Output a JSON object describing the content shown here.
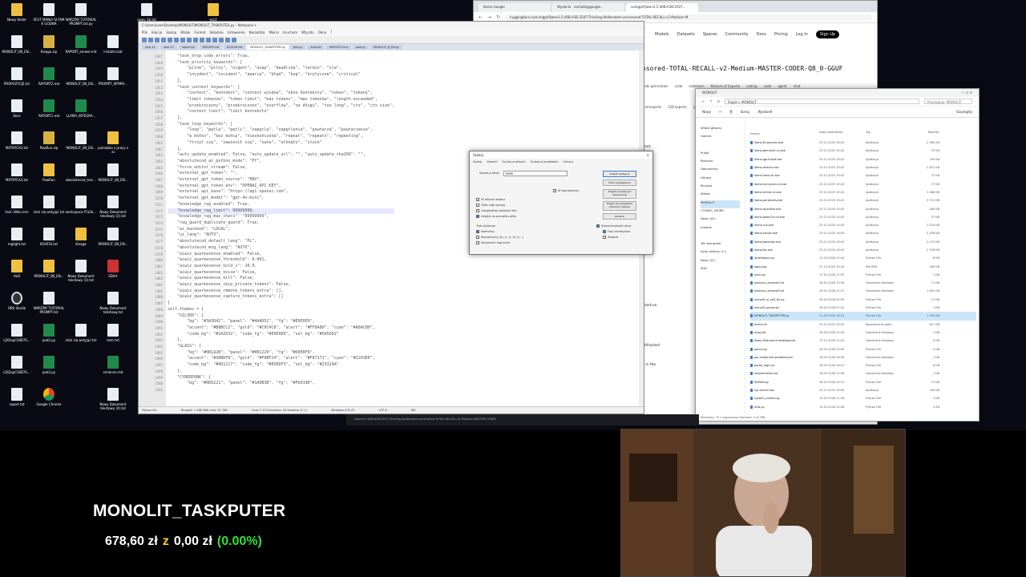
{
  "desktop_icons": [
    {
      "label": "Nowy folder",
      "kind": "folder"
    },
    {
      "label": "SFUT MANIA SI FAM K GODNA",
      "kind": "file"
    },
    {
      "label": "WARZNY TUTORIAL PROMPT.txt.py",
      "kind": "file"
    },
    {
      "label": "nowy 1b.txt",
      "kind": "file"
    },
    {
      "label": "sec2",
      "kind": "folder"
    },
    {
      "label": "MONOLIT_BII_EN...",
      "kind": "file"
    },
    {
      "label": "Księga.zip",
      "kind": "zip"
    },
    {
      "label": "RAPORT_serwer.md",
      "kind": "excel"
    },
    {
      "label": "installer.bat",
      "kind": "file"
    },
    {
      "label": "PROPOZYCJE.txt",
      "kind": "file"
    },
    {
      "label": "RAPORT2.md",
      "kind": "excel"
    },
    {
      "label": "MONOLIT_BII_EN...",
      "kind": "file"
    },
    {
      "label": "PROMPT_WYMIA...",
      "kind": "file"
    },
    {
      "label": "Kosz",
      "kind": "file"
    },
    {
      "label": "RAPORT1.md",
      "kind": "excel"
    },
    {
      "label": "LLAMA_INTEGRA...",
      "kind": "excel"
    },
    {
      "label": "MATRYCA2.txt",
      "kind": "file"
    },
    {
      "label": "PowRun.zip",
      "kind": "zip"
    },
    {
      "label": "MONOLIT_BII_EN...",
      "kind": "file"
    },
    {
      "label": "pamiątka z pracy z ai",
      "kind": "folder"
    },
    {
      "label": "MATRYCA3.txt",
      "kind": "file"
    },
    {
      "label": "PowRun",
      "kind": "folder"
    },
    {
      "label": "absolutecod_trec...",
      "kind": "file"
    },
    {
      "label": "MONOLIT_BII_EN...",
      "kind": "file"
    },
    {
      "label": "Insin Web.com",
      "kind": "file"
    },
    {
      "label": "stań się wstyjąć.txt",
      "kind": "file"
    },
    {
      "label": "workspace-f7a2b...",
      "kind": "file"
    },
    {
      "label": "Nowy Dokument tekstowy (2).txt",
      "kind": "file"
    },
    {
      "label": "mglight.txt",
      "kind": "file"
    },
    {
      "label": "810016.txt",
      "kind": "file"
    },
    {
      "label": "Księga",
      "kind": "folder"
    },
    {
      "label": "MONOLIT_BII_EN...",
      "kind": "file"
    },
    {
      "label": "HxD",
      "kind": "folder"
    },
    {
      "label": "MONOLIT_BII_EN...",
      "kind": "folder"
    },
    {
      "label": "Nowy Dokument tekstowy (3).txt",
      "kind": "file"
    },
    {
      "label": "SDArt",
      "kind": "app"
    },
    {
      "label": "OBS Studio",
      "kind": "obs"
    },
    {
      "label": "WARZNY TUTORIAL PROMPT.txt",
      "kind": "file"
    },
    {
      "label": "Nowy Dokument tekstowy.txt",
      "kind": "file"
    },
    {
      "label": "LDI2apCS0B7S...",
      "kind": "file"
    },
    {
      "label": "pad2.py",
      "kind": "excel"
    },
    {
      "label": "stań się wstyjąć.txt",
      "kind": "file"
    },
    {
      "label": "test.md",
      "kind": "file"
    },
    {
      "label": "LDI2apCS0B7S...",
      "kind": "file"
    },
    {
      "label": "pad3.py",
      "kind": "excel"
    },
    {
      "label": "zmienne.md",
      "kind": "excel"
    },
    {
      "label": "raport.txt",
      "kind": "file"
    },
    {
      "label": "Google Chrome",
      "kind": "chrome"
    },
    {
      "label": "Nowy Dokument tekstowy (4).txt",
      "kind": "file"
    }
  ],
  "editor": {
    "title": "C:\\Users\\user\\Desktop\\MONOLIT\\MONOLIT_TASKPUTER.py - Notepad++",
    "menu": [
      "Plik",
      "Edycja",
      "Szukaj",
      "Widok",
      "Format",
      "Składnia",
      "Ustawienia",
      "Narzędzia",
      "Makra",
      "Uruchom",
      "Wtyczki",
      "Okna",
      "?"
    ],
    "tabs": [
      "new 11",
      "new 12",
      "raport.py",
      "RAPORT.md",
      "810016.txt",
      "MONOLIT_TASKPUTER.py",
      "plik.py",
      "instr.txt",
      "RAPORT2.md",
      "pad.py",
      "MONOLIT_B_EN.py"
    ],
    "active_tab": "MONOLIT_TASKPUTER.py",
    "lines": [
      "    \"task_drop_code_errors\": True,",
      "    \"task_priority_keywords\": [",
      "        \"pilne\", \"pilny\", \"urgent\", \"asap\", \"deadline\", \"termin\", \"sla\",",
      "        \"incydent\", \"incident\", \"awaria\", \"błąd\", \"bug\", \"krytyczne\", \"critical\"",
      "    ],",
      "    \"task_context_keywords\": [",
      "        \"context\", \"kontekst\", \"context window\", \"okno kontekstu\", \"token\", \"tokeny\",",
      "        \"limit tokenów\", \"token limit\", \"max tokens\", \"max tokenów\", \"length exceeded\",",
      "        \"przekroczony\", \"przekroczono\", \"overflow\", \"za długi\", \"too long\", \"ctx\", \"ctx size\",",
      "        \"context limit\", \"limit kontekstu\"",
      "    ],",
      "    \"task_loop_keywords\": [",
      "        \"loop\", \"pętla\", \"pętli\", \"zapętla\", \"zapętlenie\", \"powtarza\", \"powtarzanie\",",
      "        \"w kółko\", \"bez końca\", \"nieskończona\", \"repeat\", \"repeats\", \"repeating\",",
      "        \"ftrzyl się\", \"zawiesił się\", \"sane\", \"utknęło\", \"stuck\"",
      "    ],",
      "    \"auto_update_enabled\": False, \"auto_update_url\": \"\", \"auto_update_sha256\": \"\",",
      "    \"absolutecod_ai_python_mode\": \"PY\",",
      "    \"force_editor_stream\": False,",
      "    \"external_gpt_token\": \"\",",
      "    \"external_gpt_token_source\": \"ENV\",",
      "    \"external_gpt_token_env\": \"OPENAI_API_KEY\",",
      "    \"external_api_base\": \"https://api.openai.com\",",
      "    \"external_gpt_model\": \"gpt-4o-mini\",",
      "    \"knowledge_rag_enabled\": True,",
      "    \"knowledge_rag_limit\": 99999999,",
      "    \"knowledge_rag_max_chars\": \"99999999\",",
      "    \"rag_guard_duplicate_guard\": True,",
      "    \"ai_backend\": \"LOCAL\",",
      "    \"ui_lang\": \"AUTO\",",
      "    \"absolutecod_default_lang\": \"PL\",",
      "    \"absolutecod_msg_lang\": \"AUTO\",",
      "    \"aiwiz_quarkesense_enabled\": False,",
      "    \"aiwiz_quarkesense_threshold\": 0.001,",
      "    \"aiwiz_quarkesense_hold_s\": 10.0,",
      "    \"aiwiz_quarkesense_noise\": False,",
      "    \"aiwiz_quarkesense_kill\": False,",
      "    \"aiwiz_quarkesense_skip_private_tokens\": False,",
      "    \"aiwiz_quarkesense_remote_tokens_extra\": [],",
      "    \"aiwiz_quarkesense_capture_tokens_extra\": []",
      "}",
      "",
      "self.themes = {",
      "    \"SILVER\": {",
      "        \"bg\": \"#3A3D42\", \"panel\": \"#4A4D52\", \"fg\": \"#E0E0E0\",",
      "        \"accent\": \"#B8BCC2\", \"gold\": \"#C0C4C8\", \"alert\": \"#FF8A80\", \"cyan\": \"#A8ACB0\",",
      "        \"code_bg\": \"#2A2D32\", \"code_fg\": \"#E0E0E0\", \"sel_bg\": \"#5A5D62\"",
      "    },",
      "    \"GLASS\": {",
      "        \"bg\": \"#0B1A2B\", \"panel\": \"#0B1220\", \"fg\": \"#D0E8F8\",",
      "        \"accent\": \"#38BDF8\", \"gold\": \"#F0BF24\", \"alert\": \"#F87171\", \"cyan\": \"#22D3EE\",",
      "        \"code_bg\": \"#0D1117\", \"code_fg\": \"#E6EDF3\", \"sel_bg\": \"#23324A\"",
      "    },",
      "    \"CYBERPUNK\": {",
      "        \"bg\": \"#0D0221\", \"panel\": \"#1A0B3B\", \"fg\": \"#F6019D\","
    ],
    "first_line_no": 2447,
    "status": {
      "filetype": "Python file",
      "length": "Długość: 1 488 388   Linie: 31 768",
      "position": "Linia: 2 473   Kolumna: 45   Selekcja: 8 | 1",
      "eol": "Windows (CR LF)",
      "encoding": "UTF-8",
      "ins": "INS"
    }
  },
  "search_dialog": {
    "title": "Szukaj",
    "tabs": [
      "Szukaj",
      "Zamień",
      "Szukaj w plikach",
      "Szukaj w projektach",
      "Oznacz"
    ],
    "field_label": "Szukany tekst:",
    "field_value": "9999",
    "buttons": [
      "Znajdź następny",
      "Policz wystąpienia",
      "Znajdź w bieżącym dokumencie",
      "Znajdź we wszystkich otwartych plikach",
      "Zamknij"
    ],
    "in_selection": "W zaznaczeniu",
    "options": [
      {
        "label": "W tekście wstecz",
        "checked": false
      },
      {
        "label": "Tylko całe wyrazy",
        "checked": false
      },
      {
        "label": "Uwzględniaj wielkość liter",
        "checked": false
      },
      {
        "label": "Zawijaj na początku pliku",
        "checked": true
      }
    ],
    "mode_label": "Tryb szukania",
    "modes": [
      "Normalny",
      "Rozszerzony (\\n, \\r, \\t, \\0, \\x...)",
      "Wyrażenie regularne"
    ],
    "transparency_label": "Przezroczystość okna",
    "transparency_options": [
      "Gdy nieaktywne",
      "Zawsze"
    ]
  },
  "browser": {
    "tabs": [
      "Konto Google",
      "Wydanie - kontakt@google...",
      "sumgpt/Qwen3.5-40B-A3B-2507..."
    ],
    "address": "huggingface.co/sumgpt/Qwen3.5-40B-A3B-2507-Thinking-Abliterated-uncensored-TOTAL-RECALL-v2-Medium-M",
    "nav": [
      "Models",
      "Datasets",
      "Spaces",
      "Community",
      "Docs",
      "Pricing",
      "Log In",
      "Sign Up"
    ],
    "model_title": "nsored-TOTAL-RECALL-v2-Medium-MASTER-CODER-Q8_0-GGUF",
    "tags": [
      "code generation",
      "code",
      "codeseen",
      "Mixture of Experts",
      "coding",
      "code",
      "agent",
      "chat"
    ],
    "tags2": [
      "e-of-experts",
      "128 experts",
      "gguf-my-repo"
    ],
    "snippets": [
      "ered-",
      "ed",
      "rized-un",
      "ntifracted",
      "d in the"
    ]
  },
  "explorer": {
    "title": "MONOLIT",
    "breadcrumb": "Pulpit  >  MONOLIT",
    "search_placeholder": "Przeszukaj: MONOLIT",
    "commands": [
      "Nowy",
      "Sortuj",
      "Wyświetl",
      "Szczegóły"
    ],
    "sidebar": [
      "Widok główny",
      "Galeria",
      "",
      "Pulpit",
      "Pobrane",
      "Dokumenty",
      "Obrazy",
      "Muzyka",
      "Wideo",
      "MONOLIT",
      "COSMIC_WORK",
      "Nowy (D:)",
      "models",
      "",
      "Ten komputer",
      "Dysk lokalny (C:)",
      "Nowy (D:)",
      "Sieć"
    ],
    "columns": [
      "Nazwa",
      "Data modyfikacji",
      "Typ",
      "Rozmiar"
    ],
    "rows": [
      {
        "name": "llama-fit-params.exe",
        "date": "23.12.2025 19:43",
        "type": "Aplikacja",
        "size": "2 565 KB"
      },
      {
        "name": "llama-gemma3-cli.exe",
        "date": "23.12.2025 19:43",
        "type": "Aplikacja",
        "size": "37 KB"
      },
      {
        "name": "llama-gguf-split.exe",
        "date": "23.12.2025 19:43",
        "type": "Aplikacja",
        "size": "100 KB"
      },
      {
        "name": "llama-imatrix.exe",
        "date": "23.12.2025 19:43",
        "type": "Aplikacja",
        "size": "2 612 KB"
      },
      {
        "name": "llama-llava-cli.exe",
        "date": "23.12.2025 19:43",
        "type": "Aplikacja",
        "size": "37 KB"
      },
      {
        "name": "llama-minicpmv-cli.exe",
        "date": "23.12.2025 19:43",
        "type": "Aplikacja",
        "size": "37 KB"
      },
      {
        "name": "llama-mtmd-cli.exe",
        "date": "23.12.2025 19:43",
        "type": "Aplikacja",
        "size": "3 086 KB"
      },
      {
        "name": "llama-perplexity.exe",
        "date": "23.12.2025 19:43",
        "type": "Aplikacja",
        "size": "2 715 KB"
      },
      {
        "name": "llama-quantize.exe",
        "date": "23.12.2025 19:43",
        "type": "Aplikacja",
        "size": "260 KB"
      },
      {
        "name": "llama-qwen2vl-cli.exe",
        "date": "23.12.2025 19:43",
        "type": "Aplikacja",
        "size": "37 KB"
      },
      {
        "name": "llama-run.exe",
        "date": "23.12.2025 19:43",
        "type": "Aplikacja",
        "size": "2 514 KB"
      },
      {
        "name": "llama-server.exe",
        "date": "23.12.2025 19:43",
        "type": "Aplikacja",
        "size": "5 318 KB"
      },
      {
        "name": "llama-tokenize.exe",
        "date": "23.12.2025 19:43",
        "type": "Aplikacja",
        "size": "2 473 KB"
      },
      {
        "name": "llama-tts.exe",
        "date": "23.12.2025 19:43",
        "type": "Aplikacja",
        "size": "2 578 KB"
      },
      {
        "name": "localization.py",
        "date": "12.02.2026 12:44",
        "type": "Python File",
        "size": "8 KB"
      },
      {
        "name": "logo.png",
        "date": "27.12.2025 10:34",
        "type": "Plik PNG",
        "size": "160 KB"
      },
      {
        "name": "main.py",
        "date": "17.01.2026 11:53",
        "type": "Python File",
        "size": "1 KB"
      },
      {
        "name": "matryca_zmiana2.txt",
        "date": "16.01.2026 13:30",
        "type": "Dokument tekstowy",
        "size": "11 KB"
      },
      {
        "name": "matryca_zmiana3.txt",
        "date": "19.01.2026 12:13",
        "type": "Dokument tekstowy",
        "size": "1 642 KB"
      },
      {
        "name": "monolit_ui_self_fix.py",
        "date": "16.02.2026 00:59",
        "type": "Python File",
        "size": "21 KB"
      },
      {
        "name": "monolit_parser.py",
        "date": "16.02.2026 01:42",
        "type": "Python File",
        "size": "1 KB"
      },
      {
        "name": "MONOLIT_TASKPUTER.py",
        "date": "21.02.2026 18:10",
        "type": "Python File",
        "size": "1 455 KB"
      },
      {
        "name": "mtmd.dll",
        "date": "23.12.2025 19:43",
        "type": "Rozszerzenie aplik...",
        "size": "811 KB"
      },
      {
        "name": "mtpy.txt",
        "date": "18.02.2026 12:34",
        "type": "Dokument tekstowy",
        "size": "1 KB"
      },
      {
        "name": "Nowy Dokument tekstowy.txt",
        "date": "17.12.2025 11:22",
        "type": "Dokument tekstowy",
        "size": "0 KB"
      },
      {
        "name": "patcer.py",
        "date": "20.02.2026 20:50",
        "type": "Python File",
        "size": "4 KB"
      },
      {
        "name": "pip-install-bez-problemy.txt",
        "date": "16.02.2026 16:16",
        "type": "Dokument tekstowy",
        "size": "1 KB"
      },
      {
        "name": "portal_logic.py",
        "date": "18.02.2026 16:14",
        "type": "Python File",
        "size": "8 KB"
      },
      {
        "name": "requirements.txt",
        "date": "18.02.2026 12:36",
        "type": "Dokument tekstowy",
        "size": "1 KB"
      },
      {
        "name": "RAMAN.py",
        "date": "18.02.2026 14:12",
        "type": "Python File",
        "size": "13 KB"
      },
      {
        "name": "rpc-server.exe",
        "date": "23.12.2025 19:43",
        "type": "Aplikacja",
        "size": "190 KB"
      },
      {
        "name": "system_control.py",
        "date": "12.02.2026 11:16",
        "type": "Python File",
        "size": "3 KB"
      },
      {
        "name": "utils.py",
        "date": "12.02.2026 12:56",
        "type": "Python File",
        "size": "2 KB"
      }
    ],
    "selected_row": "MONOLIT_TASKPUTER.py",
    "status": "Elementy: 70    1 zaznaczony element: 1,41 MB"
  },
  "underbar_text": "Qwen3.5-40B-A3B-2507-Thinking-Abliterated-uncensored-TOTAL-RECALL-v2-Medium-MASTER-CODER",
  "overlay": {
    "title": "MONOLIT_TASKPUTER",
    "amount": "678,60 zł",
    "separator": "z",
    "goal": "0,00 zł",
    "percent": "(0.00%)"
  }
}
